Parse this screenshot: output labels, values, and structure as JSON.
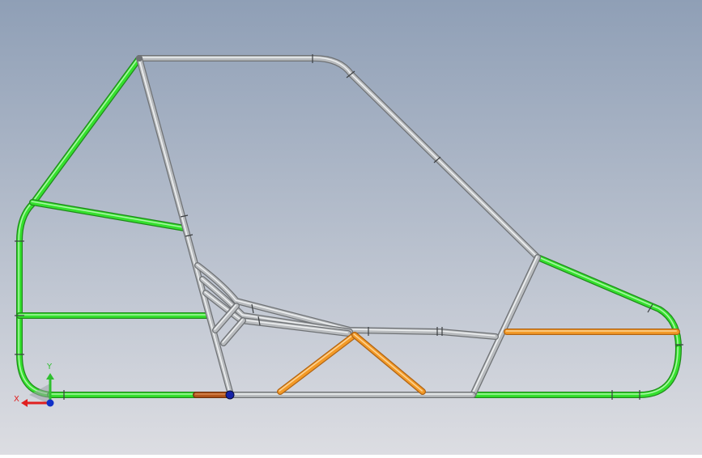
{
  "viewport": {
    "background_top": "#8f9fb6",
    "background_bottom": "#dcdde2"
  },
  "colors": {
    "steel": "#b9bcbf",
    "steel_edge": "#6f7275",
    "steel_highlight": "#eef0f1",
    "green": "#35e12e",
    "green_edge": "#1f8a1a",
    "orange": "#f39a27",
    "orange_edge": "#b06312",
    "dark_orange": "#b4561c",
    "axis_x": "#e02020",
    "axis_y": "#2fbf2f",
    "axis_z": "#1030c8",
    "origin_node": "#1522a8"
  },
  "triad": {
    "x_label": "X",
    "y_label": "Y"
  }
}
